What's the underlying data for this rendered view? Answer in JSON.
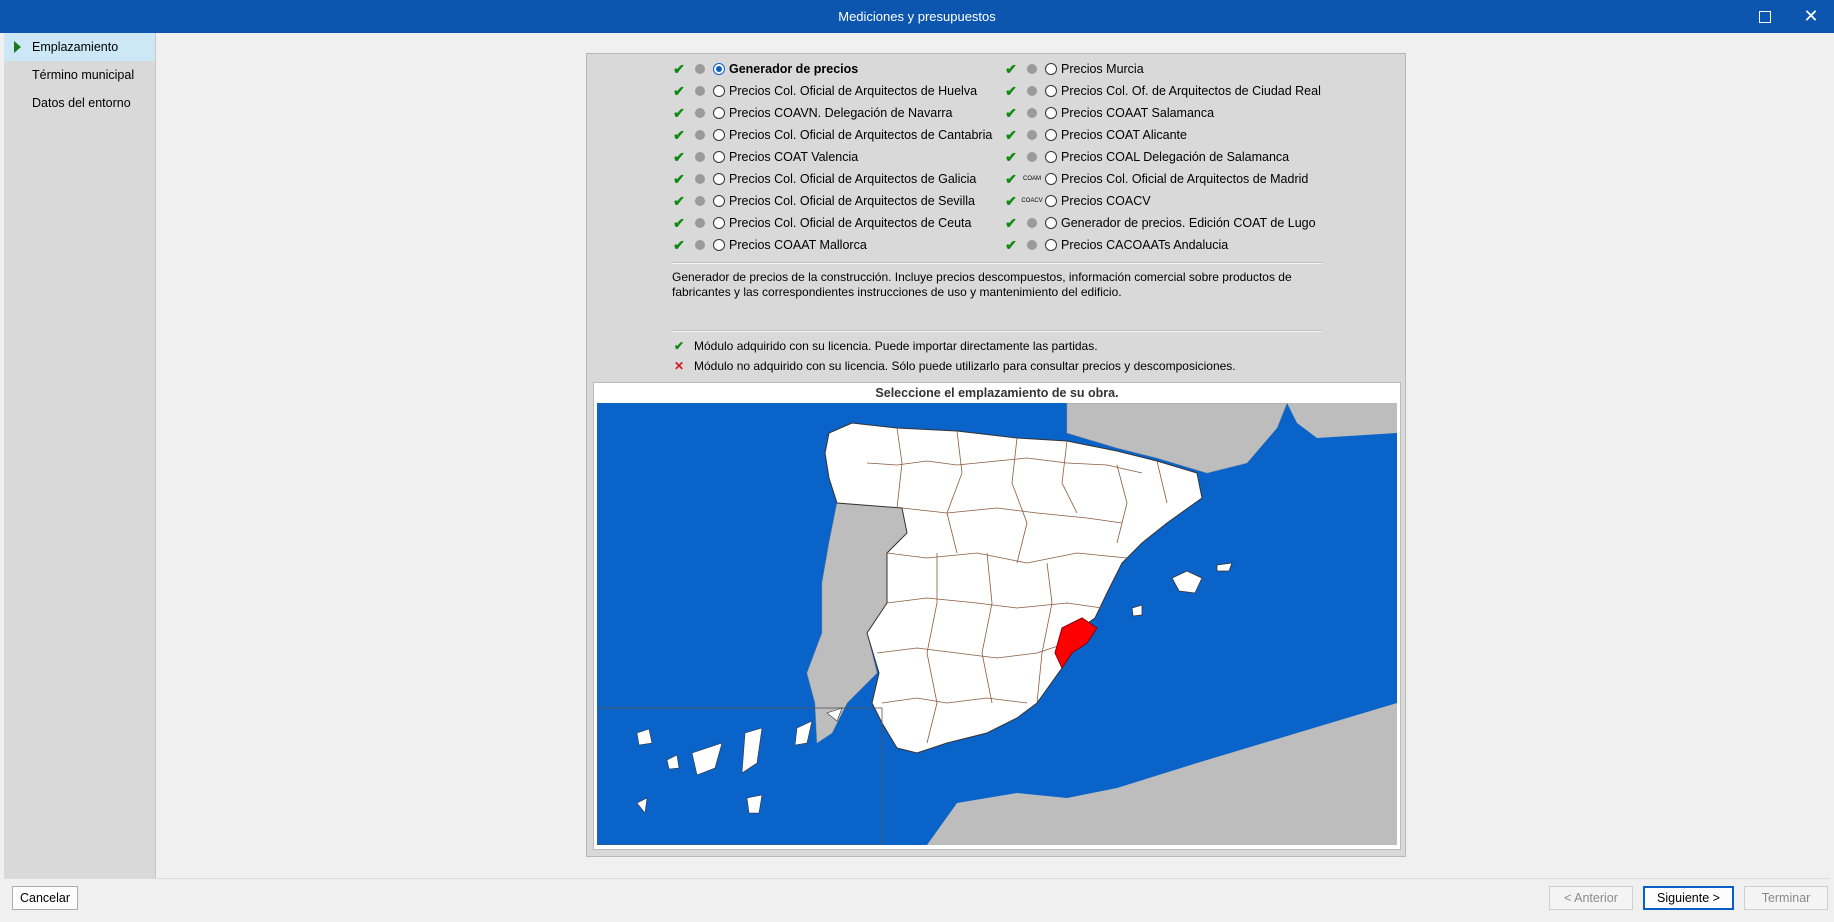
{
  "window": {
    "title": "Mediciones y presupuestos"
  },
  "steps": [
    {
      "label": "Emplazamiento",
      "active": true
    },
    {
      "label": "Término municipal",
      "active": false
    },
    {
      "label": "Datos del entorno",
      "active": false
    }
  ],
  "left_options": [
    {
      "label": "Generador de precios",
      "selected": true,
      "icon": "generador-logo-icon"
    },
    {
      "label": "Precios Col. Oficial de Arquitectos de Huelva",
      "icon": "huelva-logo-icon"
    },
    {
      "label": "Precios COAVN. Delegación de Navarra",
      "icon": "navarra-logo-icon"
    },
    {
      "label": "Precios Col. Oficial de Arquitectos de Cantabria",
      "icon": "cantabria-logo-icon"
    },
    {
      "label": "Precios COAT Valencia",
      "icon": "valencia-logo-icon"
    },
    {
      "label": "Precios Col. Oficial de Arquitectos de Galicia",
      "icon": "galicia-logo-icon"
    },
    {
      "label": "Precios Col. Oficial de Arquitectos de Sevilla",
      "icon": "sevilla-logo-icon"
    },
    {
      "label": "Precios Col. Oficial de Arquitectos de Ceuta",
      "icon": "ceuta-logo-icon"
    },
    {
      "label": "Precios COAAT Mallorca",
      "icon": "mallorca-logo-icon"
    }
  ],
  "right_options": [
    {
      "label": "Precios Murcia",
      "icon": "murcia-logo-icon"
    },
    {
      "label": "Precios Col. Of. de Arquitectos de Ciudad Real",
      "icon": "ciudad-real-logo-icon"
    },
    {
      "label": "Precios COAAT Salamanca",
      "icon": "salamanca-logo-icon"
    },
    {
      "label": "Precios COAT Alicante",
      "icon": "alicante-logo-icon"
    },
    {
      "label": "Precios COAL Delegación de Salamanca",
      "icon": "coal-salamanca-logo-icon"
    },
    {
      "label": "Precios Col. Oficial de Arquitectos de Madrid",
      "icon": "madrid-logo-icon",
      "logo_text": "COAM"
    },
    {
      "label": "Precios COACV",
      "icon": "coacv-logo-icon",
      "logo_text": "COACV"
    },
    {
      "label": "Generador de precios. Edición COAT de Lugo",
      "icon": "lugo-logo-icon"
    },
    {
      "label": "Precios CACOAATs Andalucia",
      "icon": "andalucia-logo-icon"
    }
  ],
  "description": "Generador de precios de la construcción. Incluye precios descompuestos, información comercial sobre productos de fabricantes y las correspondientes instrucciones de uso y mantenimiento del edificio.",
  "legend": {
    "acquired": "Módulo adquirido con su licencia. Puede importar directamente las partidas.",
    "not_acquired": "Módulo no adquirido con su licencia. Sólo puede utilizarlo para consultar precios y descomposiciones."
  },
  "map": {
    "title": "Seleccione el emplazamiento de su obra.",
    "selected_color": "#ff0000",
    "sea_color": "#0a63c9"
  },
  "buttons": {
    "cancel": "Cancelar",
    "previous": "< Anterior",
    "next": "Siguiente >",
    "finish": "Terminar"
  }
}
